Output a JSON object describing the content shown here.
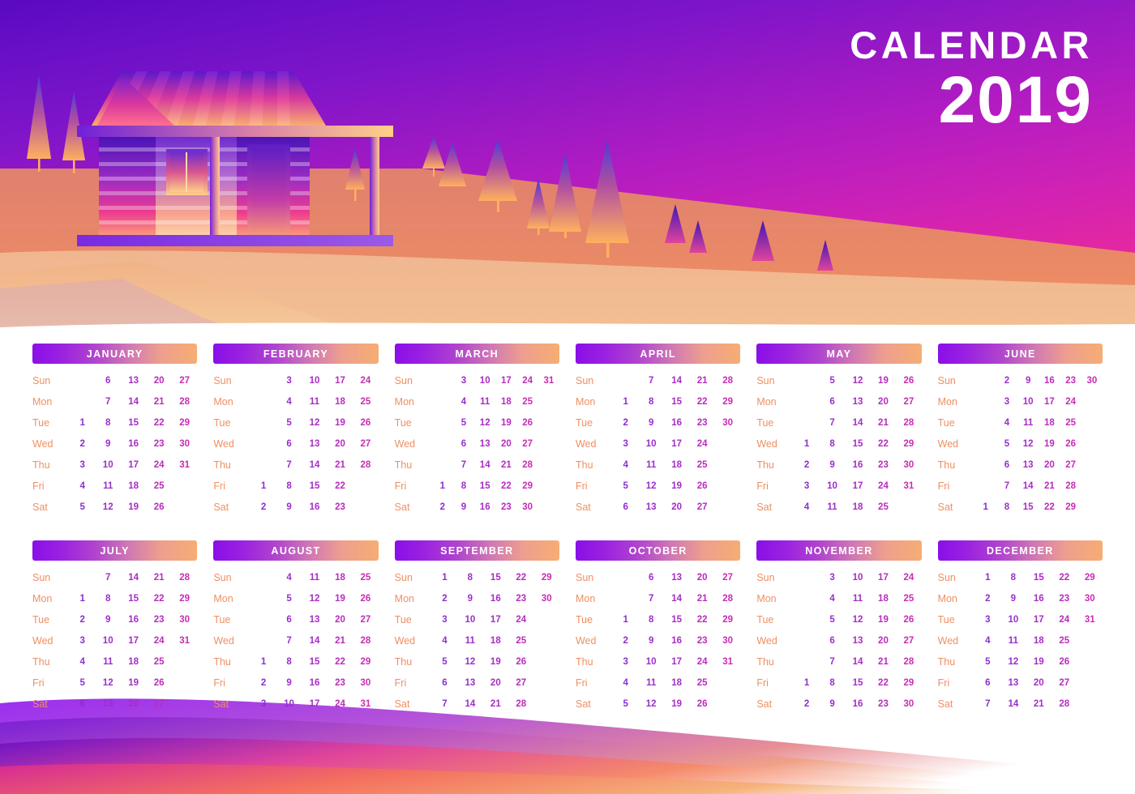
{
  "header": {
    "title_line1": "CALENDAR",
    "title_line2": "2019",
    "illustration": {
      "scene_name": "log-cabin-sunset-landscape",
      "sky_top_color": "#5a09c1",
      "sky_bottom_color": "#f03a86",
      "hill_color": "#e8846f",
      "foreground_color": "#f0b183",
      "tree_top_color": "#4b3ad8",
      "tree_bottom_color": "#ffab5e"
    }
  },
  "styles": {
    "month_header_gradient_start": "#8a0fe8",
    "month_header_gradient_end": "#f6ad73",
    "day_label_color": "#ef8f63",
    "day_number_color": "#a22cc9",
    "page_background": "#ffffff"
  },
  "weekday_labels": [
    "Sun",
    "Mon",
    "Tue",
    "Wed",
    "Thu",
    "Fri",
    "Sat"
  ],
  "footer": {
    "wave_colors": [
      "#8a2be2",
      "#7a1fd8",
      "#e0449b",
      "#f58b6a",
      "#f5b27a"
    ]
  },
  "calendar": {
    "year": "2019",
    "rows": [
      {
        "months": [
          {
            "name": "JANUARY",
            "weeks": [
              [
                "",
                "6",
                "13",
                "20",
                "27"
              ],
              [
                "",
                "7",
                "14",
                "21",
                "28"
              ],
              [
                "1",
                "8",
                "15",
                "22",
                "29"
              ],
              [
                "2",
                "9",
                "16",
                "23",
                "30"
              ],
              [
                "3",
                "10",
                "17",
                "24",
                "31"
              ],
              [
                "4",
                "11",
                "18",
                "25",
                ""
              ],
              [
                "5",
                "12",
                "19",
                "26",
                ""
              ]
            ]
          },
          {
            "name": "FEBRUARY",
            "weeks": [
              [
                "",
                "3",
                "10",
                "17",
                "24"
              ],
              [
                "",
                "4",
                "11",
                "18",
                "25"
              ],
              [
                "",
                "5",
                "12",
                "19",
                "26"
              ],
              [
                "",
                "6",
                "13",
                "20",
                "27"
              ],
              [
                "",
                "7",
                "14",
                "21",
                "28"
              ],
              [
                "1",
                "8",
                "15",
                "22",
                ""
              ],
              [
                "2",
                "9",
                "16",
                "23",
                ""
              ]
            ]
          },
          {
            "name": "MARCH",
            "weeks": [
              [
                "",
                "3",
                "10",
                "17",
                "24",
                "31"
              ],
              [
                "",
                "4",
                "11",
                "18",
                "25",
                ""
              ],
              [
                "",
                "5",
                "12",
                "19",
                "26",
                ""
              ],
              [
                "",
                "6",
                "13",
                "20",
                "27",
                ""
              ],
              [
                "",
                "7",
                "14",
                "21",
                "28",
                ""
              ],
              [
                "1",
                "8",
                "15",
                "22",
                "29",
                ""
              ],
              [
                "2",
                "9",
                "16",
                "23",
                "30",
                ""
              ]
            ]
          },
          {
            "name": "APRIL",
            "weeks": [
              [
                "",
                "7",
                "14",
                "21",
                "28"
              ],
              [
                "1",
                "8",
                "15",
                "22",
                "29"
              ],
              [
                "2",
                "9",
                "16",
                "23",
                "30"
              ],
              [
                "3",
                "10",
                "17",
                "24",
                ""
              ],
              [
                "4",
                "11",
                "18",
                "25",
                ""
              ],
              [
                "5",
                "12",
                "19",
                "26",
                ""
              ],
              [
                "6",
                "13",
                "20",
                "27",
                ""
              ]
            ]
          },
          {
            "name": "MAY",
            "weeks": [
              [
                "",
                "5",
                "12",
                "19",
                "26"
              ],
              [
                "",
                "6",
                "13",
                "20",
                "27"
              ],
              [
                "",
                "7",
                "14",
                "21",
                "28"
              ],
              [
                "1",
                "8",
                "15",
                "22",
                "29"
              ],
              [
                "2",
                "9",
                "16",
                "23",
                "30"
              ],
              [
                "3",
                "10",
                "17",
                "24",
                "31"
              ],
              [
                "4",
                "11",
                "18",
                "25",
                ""
              ]
            ]
          },
          {
            "name": "JUNE",
            "weeks": [
              [
                "",
                "2",
                "9",
                "16",
                "23",
                "30"
              ],
              [
                "",
                "3",
                "10",
                "17",
                "24",
                ""
              ],
              [
                "",
                "4",
                "11",
                "18",
                "25",
                ""
              ],
              [
                "",
                "5",
                "12",
                "19",
                "26",
                ""
              ],
              [
                "",
                "6",
                "13",
                "20",
                "27",
                ""
              ],
              [
                "",
                "7",
                "14",
                "21",
                "28",
                ""
              ],
              [
                "1",
                "8",
                "15",
                "22",
                "29",
                ""
              ]
            ]
          }
        ]
      },
      {
        "months": [
          {
            "name": "JULY",
            "weeks": [
              [
                "",
                "7",
                "14",
                "21",
                "28"
              ],
              [
                "1",
                "8",
                "15",
                "22",
                "29"
              ],
              [
                "2",
                "9",
                "16",
                "23",
                "30"
              ],
              [
                "3",
                "10",
                "17",
                "24",
                "31"
              ],
              [
                "4",
                "11",
                "18",
                "25",
                ""
              ],
              [
                "5",
                "12",
                "19",
                "26",
                ""
              ],
              [
                "6",
                "13",
                "20",
                "27",
                ""
              ]
            ]
          },
          {
            "name": "AUGUST",
            "weeks": [
              [
                "",
                "4",
                "11",
                "18",
                "25"
              ],
              [
                "",
                "5",
                "12",
                "19",
                "26"
              ],
              [
                "",
                "6",
                "13",
                "20",
                "27"
              ],
              [
                "",
                "7",
                "14",
                "21",
                "28"
              ],
              [
                "1",
                "8",
                "15",
                "22",
                "29"
              ],
              [
                "2",
                "9",
                "16",
                "23",
                "30"
              ],
              [
                "3",
                "10",
                "17",
                "24",
                "31"
              ]
            ]
          },
          {
            "name": "SEPTEMBER",
            "weeks": [
              [
                "1",
                "8",
                "15",
                "22",
                "29"
              ],
              [
                "2",
                "9",
                "16",
                "23",
                "30"
              ],
              [
                "3",
                "10",
                "17",
                "24",
                ""
              ],
              [
                "4",
                "11",
                "18",
                "25",
                ""
              ],
              [
                "5",
                "12",
                "19",
                "26",
                ""
              ],
              [
                "6",
                "13",
                "20",
                "27",
                ""
              ],
              [
                "7",
                "14",
                "21",
                "28",
                ""
              ]
            ]
          },
          {
            "name": "OCTOBER",
            "weeks": [
              [
                "",
                "6",
                "13",
                "20",
                "27"
              ],
              [
                "",
                "7",
                "14",
                "21",
                "28"
              ],
              [
                "1",
                "8",
                "15",
                "22",
                "29"
              ],
              [
                "2",
                "9",
                "16",
                "23",
                "30"
              ],
              [
                "3",
                "10",
                "17",
                "24",
                "31"
              ],
              [
                "4",
                "11",
                "18",
                "25",
                ""
              ],
              [
                "5",
                "12",
                "19",
                "26",
                ""
              ]
            ]
          },
          {
            "name": "NOVEMBER",
            "weeks": [
              [
                "",
                "3",
                "10",
                "17",
                "24"
              ],
              [
                "",
                "4",
                "11",
                "18",
                "25"
              ],
              [
                "",
                "5",
                "12",
                "19",
                "26"
              ],
              [
                "",
                "6",
                "13",
                "20",
                "27"
              ],
              [
                "",
                "7",
                "14",
                "21",
                "28"
              ],
              [
                "1",
                "8",
                "15",
                "22",
                "29"
              ],
              [
                "2",
                "9",
                "16",
                "23",
                "30"
              ]
            ]
          },
          {
            "name": "DECEMBER",
            "weeks": [
              [
                "1",
                "8",
                "15",
                "22",
                "29"
              ],
              [
                "2",
                "9",
                "16",
                "23",
                "30"
              ],
              [
                "3",
                "10",
                "17",
                "24",
                "31"
              ],
              [
                "4",
                "11",
                "18",
                "25",
                ""
              ],
              [
                "5",
                "12",
                "19",
                "26",
                ""
              ],
              [
                "6",
                "13",
                "20",
                "27",
                ""
              ],
              [
                "7",
                "14",
                "21",
                "28",
                ""
              ]
            ]
          }
        ]
      }
    ]
  }
}
